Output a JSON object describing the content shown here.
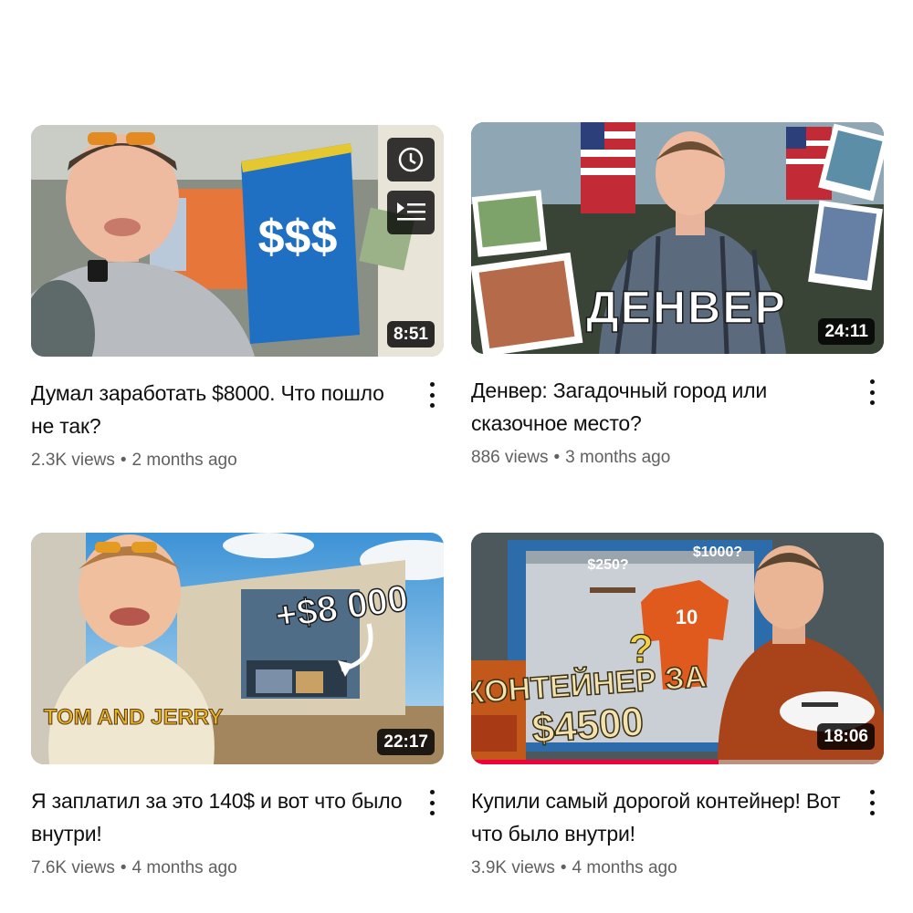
{
  "videos": [
    {
      "title": "Думал заработать $8000. Что пошло не так?",
      "views": "2.3K views",
      "age": "2 months ago",
      "duration": "8:51",
      "thumb_text": "$$$",
      "hover_actions": [
        "clock-icon",
        "add-to-queue-icon"
      ]
    },
    {
      "title": "Денвер: Загадочный город или сказочное место?",
      "views": "886 views",
      "age": "3 months ago",
      "duration": "24:11",
      "thumb_text": "ДЕНВЕР"
    },
    {
      "title": "Я заплатил за это 140$ и вот что было внутри!",
      "views": "7.6K views",
      "age": "4 months ago",
      "duration": "22:17",
      "thumb_text": "+$8 000",
      "shirt_text": "TOM AND JERRY"
    },
    {
      "title": "Купили самый дорогой контейнер! Вот что было внутри!",
      "views": "3.9K views",
      "age": "4 months ago",
      "duration": "18:06",
      "thumb_text_1": "КОНТЕЙНЕР ЗА",
      "thumb_text_2": "$4500",
      "price_tag_1": "$250?",
      "price_tag_2": "$1000?",
      "jersey_number": "10",
      "question_mark": "?",
      "watch_progress": 0.6
    }
  ],
  "separator": "•",
  "colors": {
    "progress": "#f0003c",
    "duration_bg": "#000000",
    "meta_text": "#606060"
  }
}
